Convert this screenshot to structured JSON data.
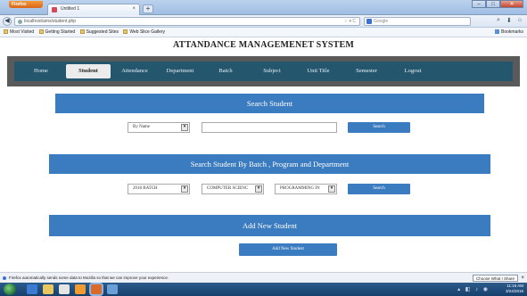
{
  "browser": {
    "app_button": "Firefox",
    "tab_title": "Untitled 1",
    "url": "localhost/ams/student.php",
    "search_engine": "Google",
    "window_controls": [
      "–",
      "□",
      "✕"
    ],
    "bookmarks": [
      "Most Visited",
      "Getting Started",
      "Suggested Sites",
      "Web Slice Gallery"
    ],
    "bookmarks_right": "Bookmarks"
  },
  "page": {
    "title": "ATTANDANCE MANAGEMENET SYSTEM"
  },
  "menu": {
    "items": [
      {
        "label": "Home",
        "active": false
      },
      {
        "label": "Student",
        "active": true
      },
      {
        "label": "Attendance",
        "active": false
      },
      {
        "label": "Department",
        "active": false
      },
      {
        "label": "Batch",
        "active": false
      },
      {
        "label": "Subject",
        "active": false
      },
      {
        "label": "Unit Title",
        "active": false
      },
      {
        "label": "Semester",
        "active": false
      },
      {
        "label": "Logout",
        "active": false
      }
    ]
  },
  "search_student": {
    "heading": "Search Student",
    "filter_value": "By Name",
    "query_value": "",
    "button": "Search"
  },
  "search_by_batch": {
    "heading": "Search Student By Batch , Program and Department",
    "batch_value": "2018 BATCH",
    "department_value": "COMPUTER SCIENC",
    "program_value": "PROGRAMMING IN",
    "button": "Search"
  },
  "add_student": {
    "heading": "Add New Student",
    "button": "Add New Student"
  },
  "notification": {
    "text": "Firefox automatically sends some data to Mozilla so that we can improve your experience.",
    "button": "Choose What I Share",
    "close": "×"
  },
  "taskbar": {
    "time": "11:16 AM",
    "date": "3/24/2016"
  },
  "colors": {
    "menu_bar": "#24566e",
    "menu_frame": "#5a5a5a",
    "section_header": "#3b7bbf",
    "button": "#3b7bbf"
  }
}
